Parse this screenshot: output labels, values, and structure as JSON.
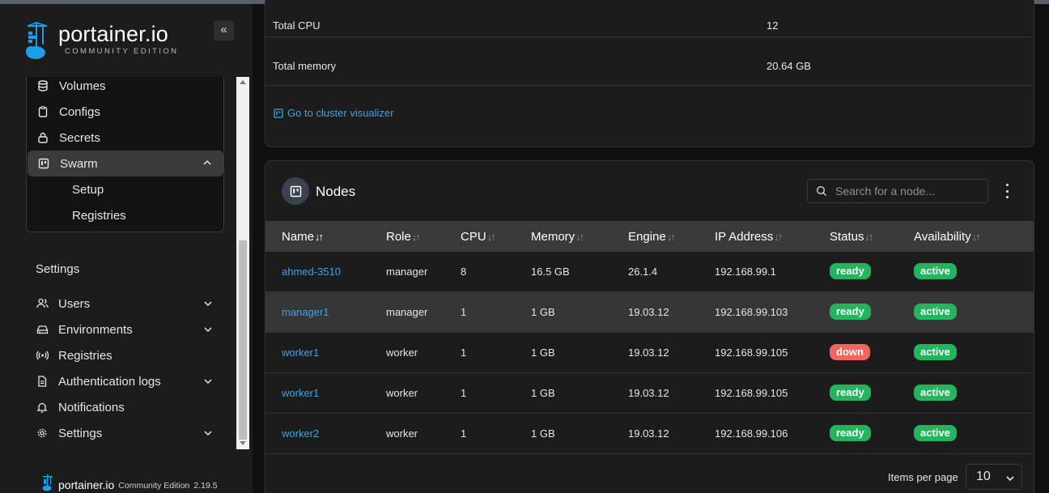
{
  "brand": {
    "name": "portainer.io",
    "edition": "COMMUNITY EDITION",
    "footer_name": "portainer.io",
    "footer_edition": "Community Edition",
    "footer_version": "2.19.5"
  },
  "sidebar": {
    "collapse_icon": "double-chevron-left-icon",
    "env_items": [
      {
        "label": "Volumes",
        "icon": "database-icon"
      },
      {
        "label": "Configs",
        "icon": "clipboard-icon"
      },
      {
        "label": "Secrets",
        "icon": "lock-icon"
      },
      {
        "label": "Swarm",
        "icon": "board-icon",
        "expanded": true
      }
    ],
    "swarm_sub": [
      "Setup",
      "Registries"
    ],
    "settings_heading": "Settings",
    "settings_items": [
      {
        "label": "Users",
        "icon": "users-icon",
        "has_children": true
      },
      {
        "label": "Environments",
        "icon": "hard-drive-icon",
        "has_children": true
      },
      {
        "label": "Registries",
        "icon": "radio-icon",
        "has_children": false
      },
      {
        "label": "Authentication logs",
        "icon": "file-text-icon",
        "has_children": true
      },
      {
        "label": "Notifications",
        "icon": "bell-icon",
        "has_children": false
      },
      {
        "label": "Settings",
        "icon": "gear-icon",
        "has_children": true
      }
    ]
  },
  "cluster_info": {
    "rows": [
      {
        "key": "Total CPU",
        "value": "12"
      },
      {
        "key": "Total memory",
        "value": "20.64 GB"
      }
    ],
    "visualizer_link": "Go to cluster visualizer"
  },
  "nodes": {
    "title": "Nodes",
    "search_placeholder": "Search for a node...",
    "columns": [
      "Name",
      "Role",
      "CPU",
      "Memory",
      "Engine",
      "IP Address",
      "Status",
      "Availability"
    ],
    "sorted_column": "Name",
    "rows": [
      {
        "name": "ahmed-3510",
        "role": "manager",
        "cpu": "8",
        "memory": "16.5 GB",
        "engine": "26.1.4",
        "ip": "192.168.99.1",
        "status": "ready",
        "availability": "active"
      },
      {
        "name": "manager1",
        "role": "manager",
        "cpu": "1",
        "memory": "1 GB",
        "engine": "19.03.12",
        "ip": "192.168.99.103",
        "status": "ready",
        "availability": "active"
      },
      {
        "name": "worker1",
        "role": "worker",
        "cpu": "1",
        "memory": "1 GB",
        "engine": "19.03.12",
        "ip": "192.168.99.105",
        "status": "down",
        "availability": "active"
      },
      {
        "name": "worker1",
        "role": "worker",
        "cpu": "1",
        "memory": "1 GB",
        "engine": "19.03.12",
        "ip": "192.168.99.105",
        "status": "ready",
        "availability": "active"
      },
      {
        "name": "worker2",
        "role": "worker",
        "cpu": "1",
        "memory": "1 GB",
        "engine": "19.03.12",
        "ip": "192.168.99.106",
        "status": "ready",
        "availability": "active"
      }
    ],
    "items_per_page_label": "Items per page",
    "items_per_page": "10"
  },
  "colors": {
    "link": "#3ea3e6",
    "ready": "#22b55e",
    "down": "#f0655c",
    "active": "#22b55e"
  }
}
